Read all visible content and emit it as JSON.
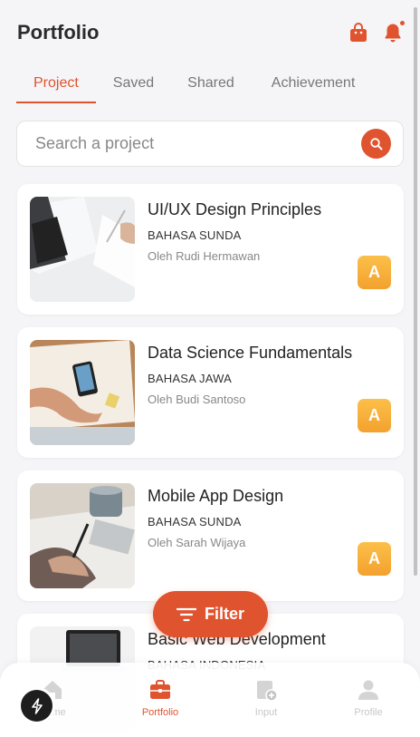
{
  "header": {
    "title": "Portfolio"
  },
  "tabs": [
    {
      "label": "Project",
      "active": true
    },
    {
      "label": "Saved",
      "active": false
    },
    {
      "label": "Shared",
      "active": false
    },
    {
      "label": "Achievement",
      "active": false
    }
  ],
  "search": {
    "placeholder": "Search a project",
    "value": ""
  },
  "projects": [
    {
      "title": "UI/UX Design Principles",
      "language": "BAHASA SUNDA",
      "author": "Oleh Rudi Hermawan",
      "grade": "A"
    },
    {
      "title": "Data Science Fundamentals",
      "language": "BAHASA JAWA",
      "author": "Oleh Budi Santoso",
      "grade": "A"
    },
    {
      "title": "Mobile App Design",
      "language": "BAHASA SUNDA",
      "author": "Oleh Sarah Wijaya",
      "grade": "A"
    },
    {
      "title": "Basic Web Development",
      "language": "BAHASA INDONESIA",
      "author": "",
      "grade": ""
    }
  ],
  "filter": {
    "label": "Filter"
  },
  "nav": [
    {
      "label": "Home",
      "icon": "home-icon",
      "active": false
    },
    {
      "label": "Portfolio",
      "icon": "briefcase-icon",
      "active": true
    },
    {
      "label": "Input",
      "icon": "add-document-icon",
      "active": false
    },
    {
      "label": "Profile",
      "icon": "user-icon",
      "active": false
    }
  ],
  "colors": {
    "accent": "#e0532f",
    "grade": "#f6ac35",
    "background": "#f5f5f7"
  }
}
